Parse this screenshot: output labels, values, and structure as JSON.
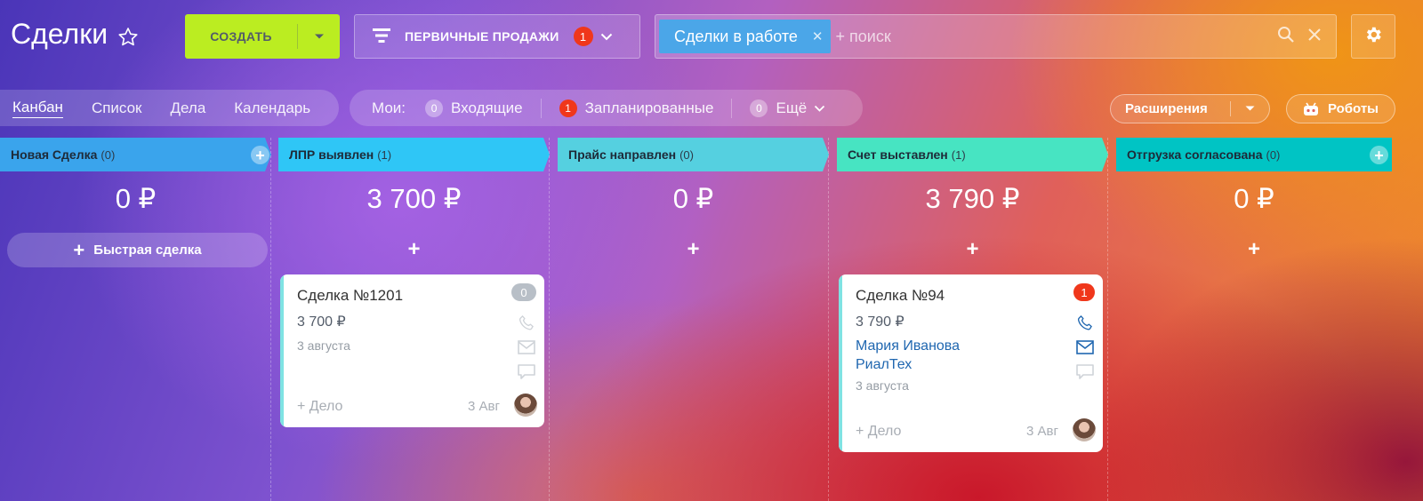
{
  "header": {
    "title": "Сделки",
    "create_label": "СОЗДАТЬ",
    "pipeline_label": "ПЕРВИЧНЫЕ ПРОДАЖИ",
    "pipeline_badge": "1",
    "search_tag": "Сделки в работе",
    "search_placeholder": "+ поиск"
  },
  "views": {
    "items": [
      "Канбан",
      "Список",
      "Дела",
      "Календарь"
    ],
    "active": "Канбан"
  },
  "counters": {
    "mine_label": "Мои:",
    "incoming_count": "0",
    "incoming_label": "Входящие",
    "planned_count": "1",
    "planned_label": "Запланированные",
    "more_count": "0",
    "more_label": "Ещё"
  },
  "toolbar": {
    "extensions_label": "Расширения",
    "robots_label": "Роботы"
  },
  "colors": {
    "create_button": "#bbed21",
    "red_badge": "#f0371b",
    "link_blue": "#2067b0",
    "stage_new": "#3aa4ec",
    "stage_lpr": "#2fc6f6",
    "stage_price": "#55d0e0",
    "stage_invoice": "#47e4c2",
    "stage_shipping": "#00c4c4"
  },
  "columns": [
    {
      "name": "Новая Сделка",
      "count": "(0)",
      "sum": "0 ₽",
      "quick_label": "Быстрая сделка"
    },
    {
      "name": "ЛПР выявлен",
      "count": "(1)",
      "sum": "3 700 ₽",
      "add": "+"
    },
    {
      "name": "Прайс направлен",
      "count": "(0)",
      "sum": "0 ₽",
      "add": "+"
    },
    {
      "name": "Счет выставлен",
      "count": "(1)",
      "sum": "3 790 ₽",
      "add": "+"
    },
    {
      "name": "Отгрузка согласована",
      "count": "(0)",
      "sum": "0 ₽",
      "add": "+"
    }
  ],
  "cards": [
    {
      "title": "Сделка №1201",
      "sum": "3 700 ₽",
      "date": "3 августа",
      "badge": "0",
      "activity": "+ Дело",
      "short_date": "3 Авг",
      "icons": [
        "phone-icon",
        "mail-icon",
        "chat-icon"
      ]
    },
    {
      "title": "Сделка №94",
      "sum": "3 790 ₽",
      "contact_name": "Мария Иванова",
      "company": "РиалТех",
      "date": "3 августа",
      "badge": "1",
      "activity": "+ Дело",
      "short_date": "3 Авг",
      "icons": [
        "phone-icon",
        "mail-icon",
        "chat-icon"
      ]
    }
  ]
}
